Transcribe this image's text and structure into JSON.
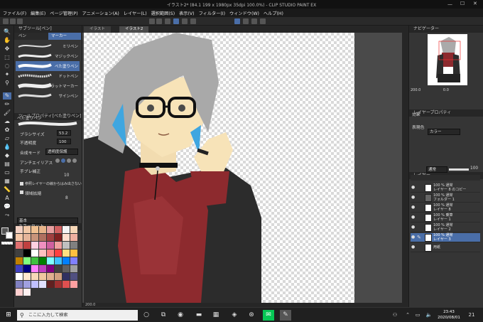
{
  "window": {
    "title": "イラスト2* (84.1 199 x 1980px 35dpi 100.0%) - CLIP STUDIO PAINT EX"
  },
  "menubar": {
    "items": [
      "ファイル(F)",
      "編集(E)",
      "ページ管理(P)",
      "アニメーション(A)",
      "レイヤー(L)",
      "選択範囲(S)",
      "表示(V)",
      "フィルター(I)",
      "ウィンドウ(W)",
      "ヘルプ(H)"
    ]
  },
  "subtool": {
    "header": "サブツール[ペン]",
    "tabs": [
      "ペン",
      "マーカー"
    ],
    "brushes": [
      "ミリペン",
      "マジックペン",
      "べた塗りペン",
      "ドットペン",
      "フラットマーカー",
      "サインペン"
    ]
  },
  "toolprops": {
    "header": "ツールプロパティ[べた塗りペン]",
    "brush_name": "べた塗りペン",
    "brush_size_label": "ブラシサイズ",
    "brush_size_value": "53.2",
    "opacity_label": "不透明度",
    "opacity_value": "100",
    "blend_label": "合成モード",
    "blend_value": "透明度保護",
    "aa_label": "アンチエイリアス",
    "stab_label": "手ブレ補正",
    "stab_value": "10",
    "ref_label": "参照レイヤーの線からはみ出さない",
    "region_label": "領域拡縮",
    "region_value": "8"
  },
  "colorset": {
    "header": "カラーセット",
    "set_name": "基本"
  },
  "document": {
    "tabs": [
      "イラスト",
      "イラスト2"
    ],
    "status": "200.0"
  },
  "navigator": {
    "header": "ナビゲーター",
    "zoom": "200.0",
    "angle": "0.0"
  },
  "layerprops": {
    "header": "レイヤープロパティ",
    "effect_label": "効果",
    "expr_label": "表現色",
    "expr_value": "カラー"
  },
  "layers": {
    "header": "レイヤー",
    "blend": "通常",
    "opacity": "100",
    "rows": [
      {
        "line1": "100 % 通常",
        "line2": "レイヤー 8 のコピー"
      },
      {
        "line1": "100 % 通常",
        "line2": "フォルダー 1"
      },
      {
        "line1": "100 % 通常",
        "line2": "レイヤー 8"
      },
      {
        "line1": "100 % 乗算",
        "line2": "レイヤー 1"
      },
      {
        "line1": "100 % 通常",
        "line2": "レイヤー 2"
      },
      {
        "line1": "100 % 通常",
        "line2": "レイヤー 3"
      },
      {
        "line1": "",
        "line2": "用紙"
      }
    ]
  },
  "taskbar": {
    "search_placeholder": "ここに入力して検索",
    "time": "23:43",
    "date": "2020/08/01",
    "notification_count": "21"
  },
  "colors": {
    "accent": "#4a6ea8",
    "palette": [
      "#f4d2c4",
      "#f2c9a8",
      "#f0c090",
      "#e8b48a",
      "#e8a0a0",
      "#d06060",
      "#f4f4f4",
      "#f6d6b6",
      "#f5c9a9",
      "#e5b59a",
      "#c8947a",
      "#b07060",
      "#a04040",
      "#802020",
      "#ffe0d0",
      "#f0b0a0",
      "#e07070",
      "#c04040",
      "#ffd0e0",
      "#f090c0",
      "#d060a0",
      "#f0a0a0",
      "#c0c0c0",
      "#808080",
      "#404040",
      "#000000",
      "#ffffff",
      "#ffc0c0",
      "#ff8080",
      "#ff4040",
      "#ffe080",
      "#ffc040",
      "#c08000",
      "#80ff80",
      "#40c040",
      "#008000",
      "#80ffff",
      "#40c0ff",
      "#0080ff",
      "#8080ff",
      "#4040c0",
      "#000080",
      "#ff80ff",
      "#c040c0",
      "#800080",
      "#404040",
      "#606060",
      "#a0a0a0",
      "#ffffff",
      "#ffe8d0",
      "#f8d8b8",
      "#f0c8a0",
      "#e0b090",
      "#d0a080",
      "#303060",
      "#505080",
      "#8080c0",
      "#a0a0e0",
      "#c0c0ff",
      "#e0e0ff",
      "#602020",
      "#a03030",
      "#e05050",
      "#ffa0a0",
      "#ffd0d0",
      "#fff0f0"
    ]
  }
}
